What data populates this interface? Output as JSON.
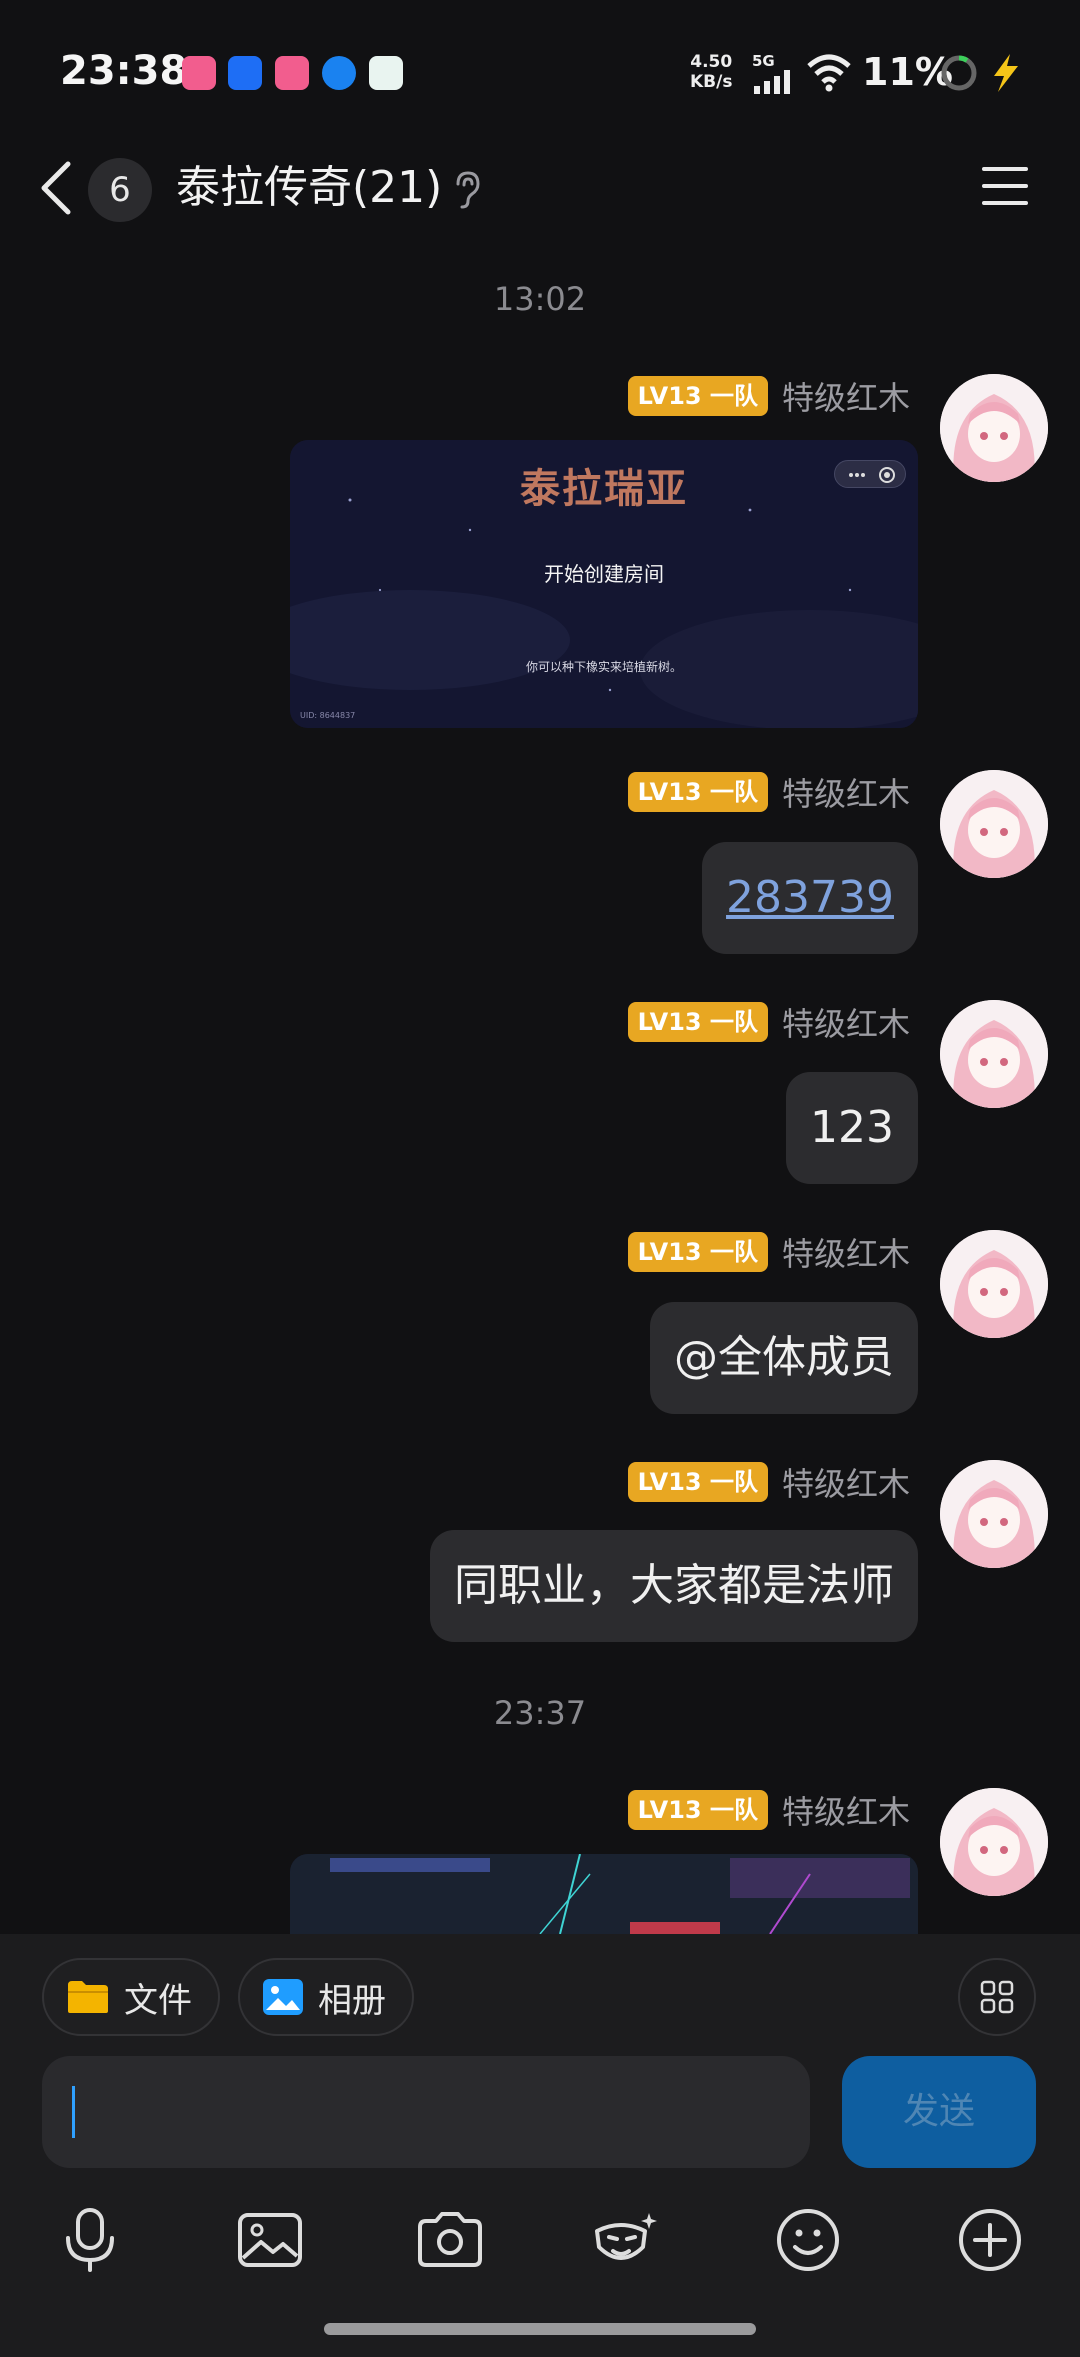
{
  "status_bar": {
    "time": "23:38",
    "net_speed_value": "4.50",
    "net_speed_unit": "KB/s",
    "network_type": "5G",
    "battery_percent": "11%",
    "app_icons": [
      "bilibili-icon",
      "scissors-app-icon",
      "bilibili-icon",
      "browser-icon",
      "chat-app-icon"
    ],
    "icons": [
      "signal-icon",
      "wifi-icon",
      "battery-ring-icon",
      "charging-bolt-icon"
    ]
  },
  "header": {
    "unread_count": "6",
    "title": "泰拉传奇(21)",
    "icons": [
      "back-chevron-icon",
      "ear-icon",
      "menu-icon"
    ]
  },
  "messages": {
    "timestamp_1": "13:02",
    "timestamp_2": "23:37",
    "level_badge": "LV13 一队",
    "sender_name": "特级红木",
    "card1": {
      "logo_text": "泰拉瑞亚",
      "title": "开始创建房间",
      "tip": "你可以种下橡实来培植新树。",
      "uid": "UID: 8644837"
    },
    "msg_283739": "283739",
    "msg_123": "123",
    "msg_at_all": "@全体成员",
    "msg_same_class": "同职业，大家都是法师"
  },
  "bottom": {
    "file_label": "文件",
    "album_label": "相册",
    "send_label": "发送",
    "input_value": "",
    "toolbar_icons": [
      "microphone-icon",
      "image-icon",
      "camera-icon",
      "sticker-icon",
      "emoji-icon",
      "plus-icon"
    ]
  },
  "colors": {
    "background": "#111113",
    "bubble": "#2c2c2f",
    "level_badge": "#e8a722",
    "link": "#7fa2dd",
    "send_button": "#0e5ea0",
    "cursor": "#2fa0ff"
  }
}
